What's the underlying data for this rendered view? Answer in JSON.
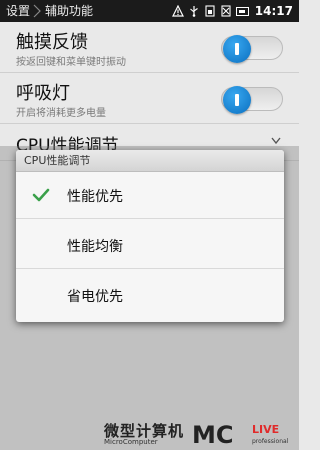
{
  "statusbar": {
    "breadcrumb": [
      "设置",
      "辅助功能"
    ],
    "time": "14:17",
    "icons": [
      "warning-icon",
      "usb-icon",
      "sim-icon",
      "no-sim-icon",
      "battery-icon"
    ]
  },
  "settings": {
    "touch_feedback": {
      "title": "触摸反馈",
      "summary": "按返回键和菜单键时振动",
      "toggle_on": true
    },
    "breathing_light": {
      "title": "呼吸灯",
      "summary": "开启将消耗更多电量",
      "toggle_on": true
    },
    "cpu": {
      "title": "CPU性能调节"
    }
  },
  "dialog": {
    "title": "CPU性能调节",
    "options": [
      {
        "label": "性能优先",
        "selected": true
      },
      {
        "label": "性能均衡",
        "selected": false
      },
      {
        "label": "省电优先",
        "selected": false
      }
    ]
  },
  "watermark": {
    "cn": "微型计算机",
    "en": "MicroComputer",
    "logo_main": "MC",
    "logo_side_top": "LIVE",
    "logo_side_bottom": "professional"
  },
  "colors": {
    "accent_check": "#3aa04a",
    "toggle_knob": "#1a86d6",
    "status_bar": "#1b1b1b",
    "logo_red": "#e02b2b"
  }
}
